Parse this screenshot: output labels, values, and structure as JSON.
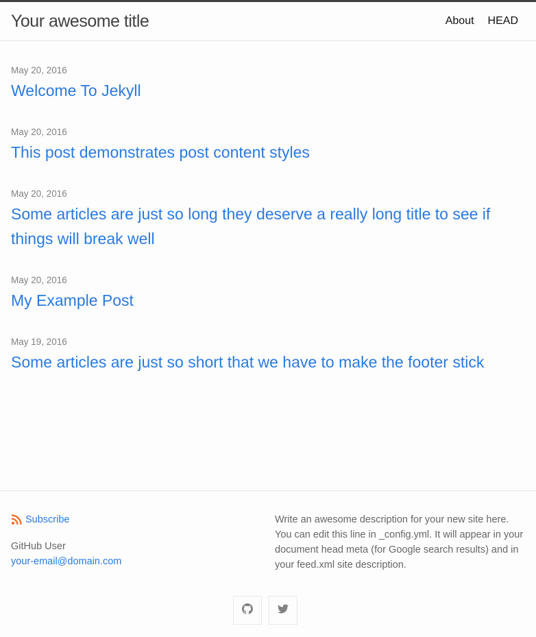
{
  "header": {
    "site_title": "Your awesome title",
    "nav": [
      {
        "label": "About"
      },
      {
        "label": "HEAD"
      }
    ]
  },
  "posts": [
    {
      "date": "May 20, 2016",
      "title": "Welcome To Jekyll"
    },
    {
      "date": "May 20, 2016",
      "title": "This post demonstrates post content styles"
    },
    {
      "date": "May 20, 2016",
      "title": "Some articles are just so long they deserve a really long title to see if things will break well"
    },
    {
      "date": "May 20, 2016",
      "title": "My Example Post"
    },
    {
      "date": "May 19, 2016",
      "title": "Some articles are just so short that we have to make the footer stick"
    }
  ],
  "footer": {
    "subscribe_label": "Subscribe",
    "author_name": "GitHub User",
    "email": "your-email@domain.com",
    "description": "Write an awesome description for your new site here. You can edit this line in _config.yml. It will appear in your document head meta (for Google search results) and in your feed.xml site description.",
    "social_icons": [
      "github-icon",
      "twitter-icon"
    ]
  },
  "colors": {
    "link": "#2a7ae2",
    "rss": "#f26522",
    "muted": "#828282",
    "header_border": "#424242"
  }
}
